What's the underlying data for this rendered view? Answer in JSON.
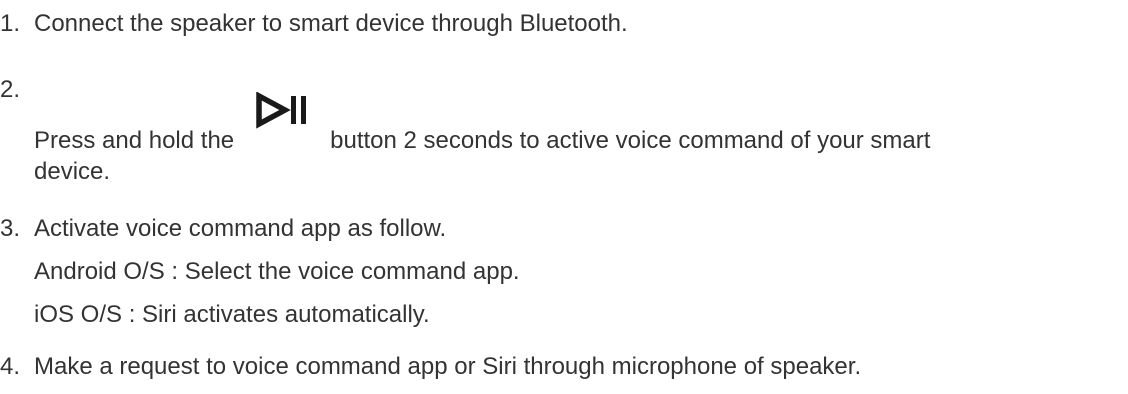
{
  "steps": [
    {
      "number": "1.",
      "text": "Connect the speaker to smart device through Bluetooth."
    },
    {
      "number": "2.",
      "text_before": "Press and hold the",
      "icon": "play-pause-icon",
      "text_after": "button 2 seconds to active voice command of your smart",
      "text_cont": "device."
    },
    {
      "number": "3.",
      "text": "Activate voice command app as follow.",
      "sub_lines": [
        "Android O/S : Select the voice command app.",
        "iOS O/S : Siri activates automatically."
      ]
    },
    {
      "number": "4.",
      "text": "Make a request to voice command app or Siri through microphone of speaker."
    }
  ],
  "colors": {
    "text": "#333333",
    "icon": "#1a1a1a"
  }
}
